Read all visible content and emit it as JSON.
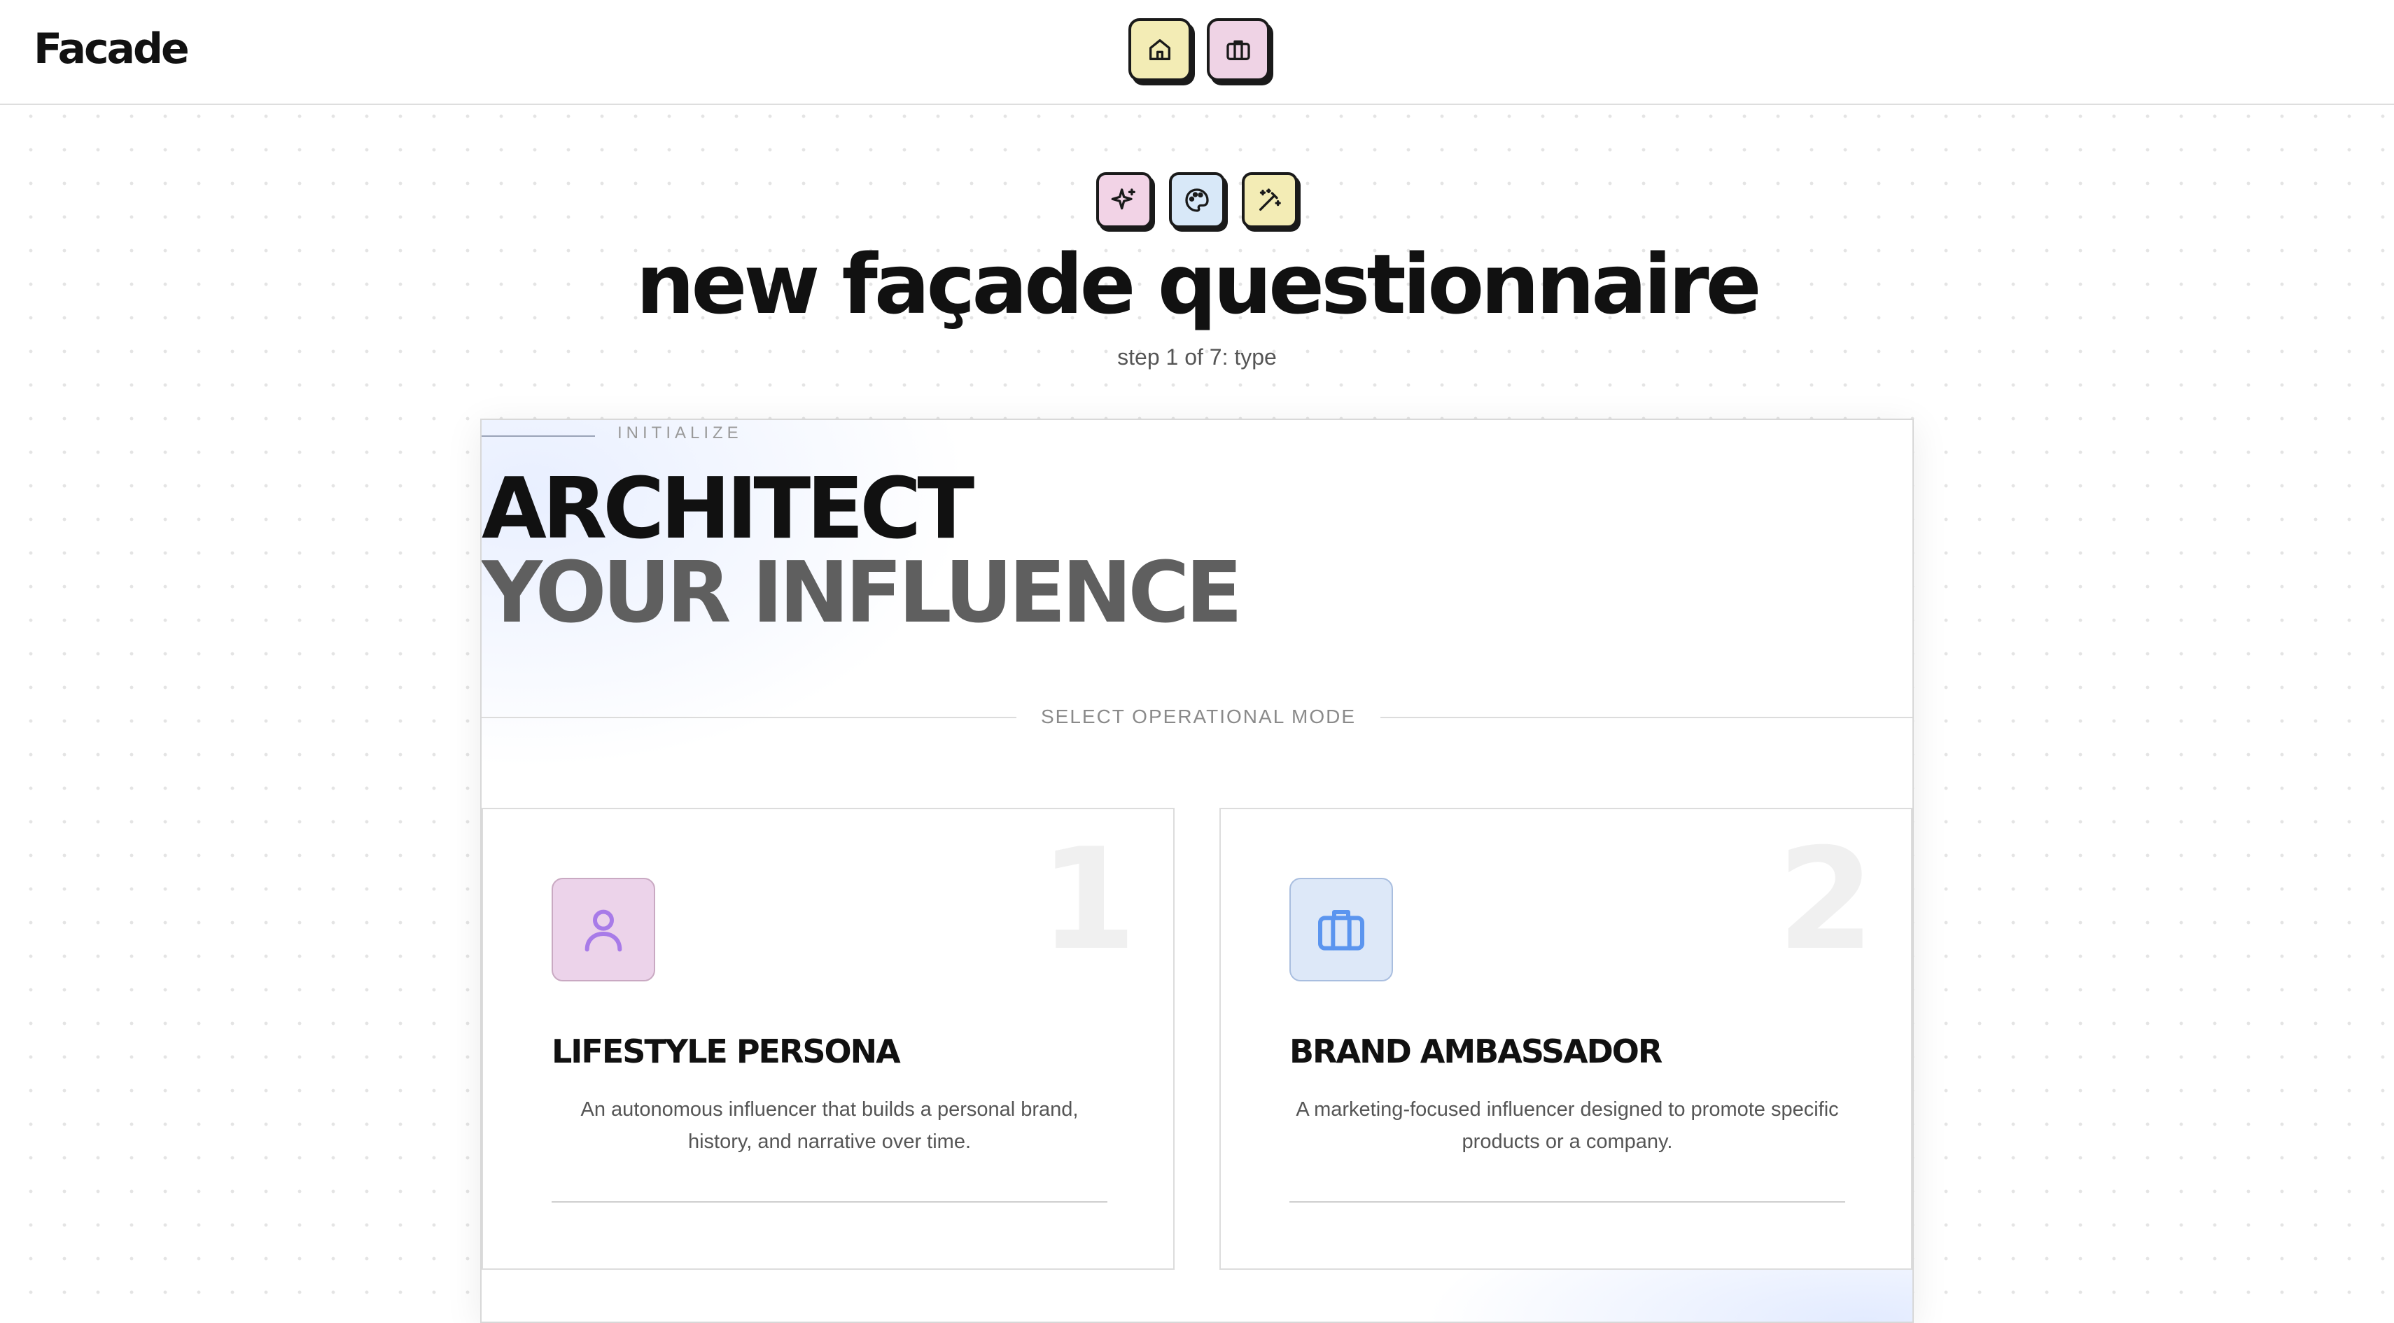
{
  "app": {
    "name": "Facade"
  },
  "nav": {
    "items": [
      {
        "icon": "home-icon",
        "color": "#f3ecb5"
      },
      {
        "icon": "briefcase-icon",
        "color": "#efd3e5"
      }
    ]
  },
  "header": {
    "icons": [
      {
        "icon": "sparkles-icon",
        "color": "#f2d3e6"
      },
      {
        "icon": "palette-icon",
        "color": "#d8e8f8"
      },
      {
        "icon": "magic-wand-icon",
        "color": "#f3ecb5"
      }
    ],
    "title": "new façade questionnaire",
    "step": "step 1 of 7: type"
  },
  "card": {
    "eyebrow": "INITIALIZE",
    "hero_line1": "ARCHITECT",
    "hero_line2": "YOUR INFLUENCE",
    "divider_label": "SELECT OPERATIONAL MODE",
    "options": [
      {
        "number": "1",
        "icon": "user-icon",
        "icon_bg": "#ecd3ea",
        "icon_color": "#a87be8",
        "title": "LIFESTYLE PERSONA",
        "description": "An autonomous influencer that builds a personal brand, history, and narrative over time."
      },
      {
        "number": "2",
        "icon": "briefcase-icon",
        "icon_bg": "#dde8f8",
        "icon_color": "#5b95ef",
        "title": "BRAND AMBASSADOR",
        "description": "A marketing-focused influencer designed to promote specific products or a company."
      }
    ]
  }
}
